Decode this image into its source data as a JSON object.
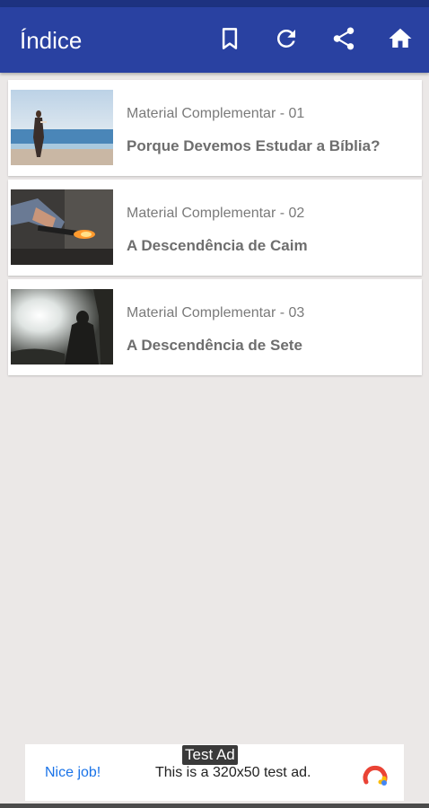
{
  "appbar": {
    "title": "Índice",
    "color": "#2941a1",
    "icons": [
      "bookmark-icon",
      "refresh-icon",
      "share-icon",
      "home-icon"
    ]
  },
  "items": [
    {
      "subtitle": "Material Complementar - 01",
      "title": "Porque Devemos Estudar a Bíblia?",
      "thumbnail": "woman-on-beach"
    },
    {
      "subtitle": "Material Complementar - 02",
      "title": "A Descendência de Caim",
      "thumbnail": "blacksmith-forge"
    },
    {
      "subtitle": "Material Complementar - 03",
      "title": "A Descendência de Sete",
      "thumbnail": "person-in-sunlight"
    }
  ],
  "ad": {
    "badge": "Test Ad",
    "nice": "Nice job!",
    "text": "This is a 320x50 test ad.",
    "icon": "ad-choices-logo"
  }
}
